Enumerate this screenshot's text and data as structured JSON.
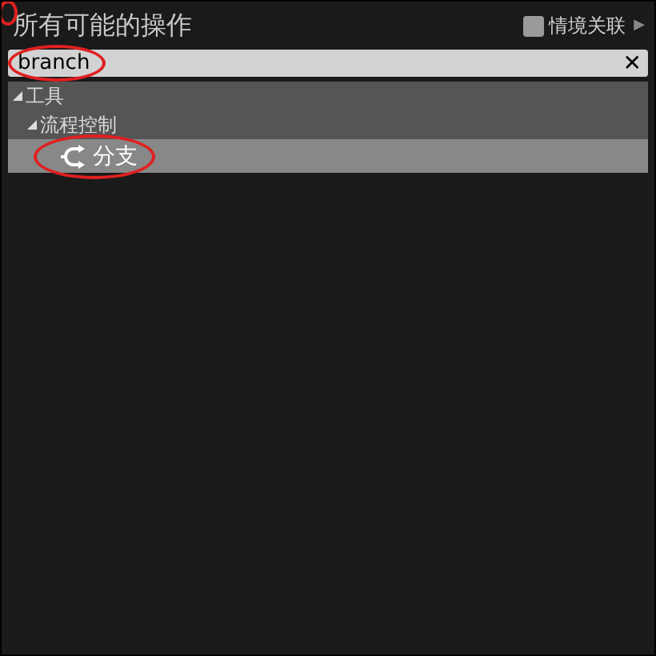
{
  "window": {
    "title": "所有可能的操作"
  },
  "context_toggle": {
    "label": "情境关联",
    "checked": false,
    "arrow": "▶"
  },
  "search": {
    "value": "branch",
    "highlighted": true,
    "clear": "✕"
  },
  "tree": [
    {
      "label": "工具",
      "expanded": true,
      "children": [
        {
          "label": "流程控制",
          "expanded": true,
          "children": [
            {
              "label": "分支",
              "kind": "branch",
              "selected": true,
              "highlighted": true
            }
          ]
        }
      ]
    }
  ]
}
